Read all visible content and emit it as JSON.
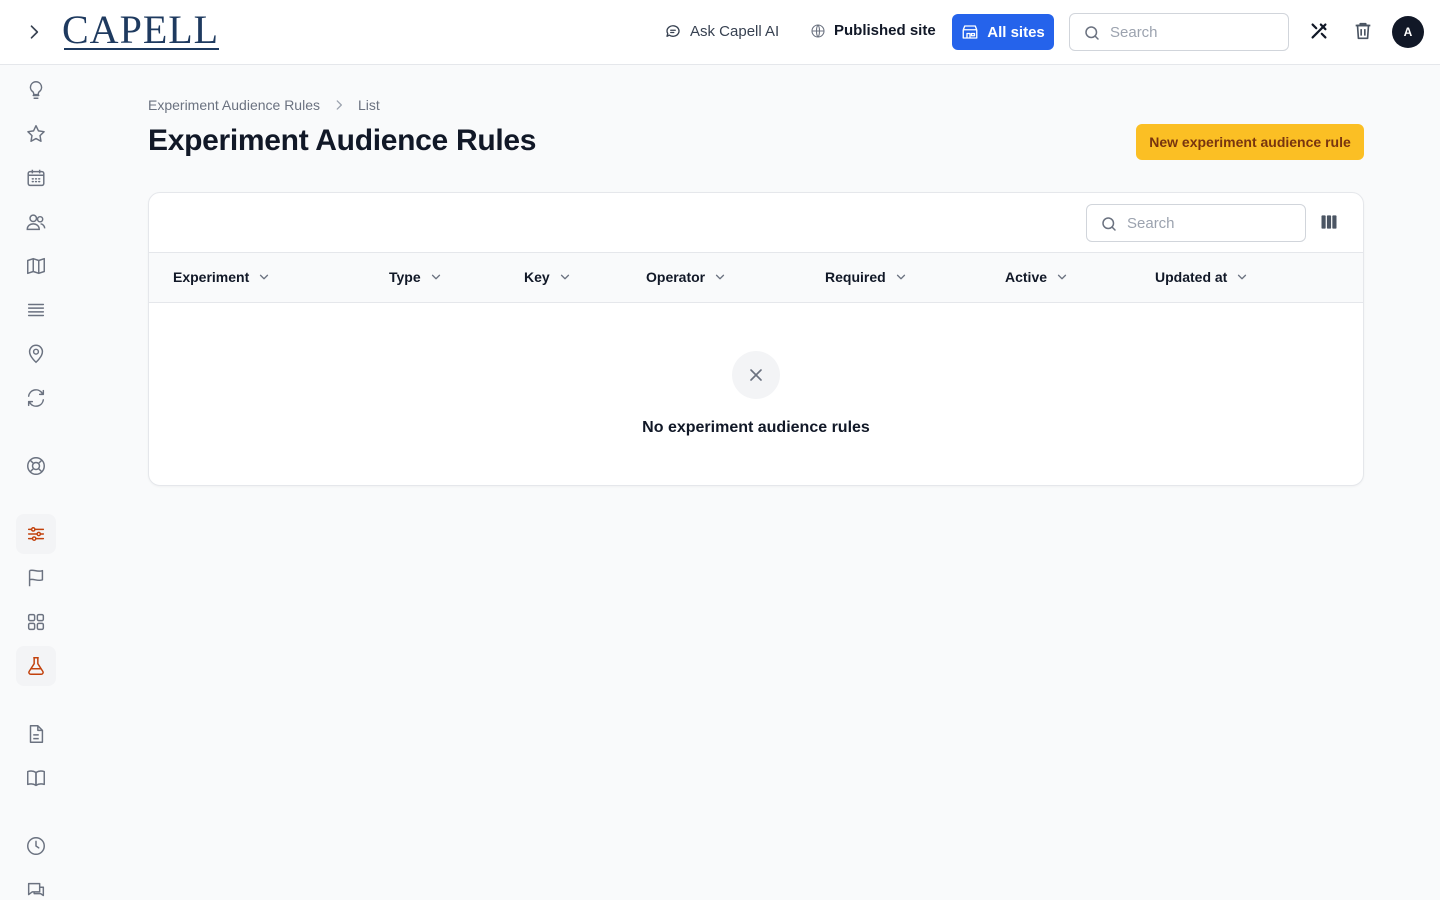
{
  "header": {
    "logo": "CAPELL",
    "ask_ai": "Ask Capell AI",
    "published_site": "Published site",
    "all_sites": "All sites",
    "search_placeholder": "Search",
    "avatar_initial": "A"
  },
  "breadcrumb": {
    "parent": "Experiment Audience Rules",
    "current": "List"
  },
  "page": {
    "title": "Experiment Audience Rules",
    "new_button": "New experiment audience rule"
  },
  "table": {
    "search_placeholder": "Search",
    "columns": [
      "Experiment",
      "Type",
      "Key",
      "Operator",
      "Required",
      "Active",
      "Updated at"
    ],
    "empty_message": "No experiment audience rules"
  },
  "sidebar": {
    "items": [
      {
        "icon": "lightbulb-icon"
      },
      {
        "icon": "star-icon"
      },
      {
        "icon": "calendar-icon"
      },
      {
        "icon": "users-icon"
      },
      {
        "icon": "map-icon"
      },
      {
        "icon": "list-icon"
      },
      {
        "icon": "map-pin-icon"
      },
      {
        "icon": "refresh-icon"
      },
      {
        "icon": "lifebuoy-icon"
      },
      {
        "icon": "sliders-icon",
        "active": true
      },
      {
        "icon": "flag-icon"
      },
      {
        "icon": "grid-icon"
      },
      {
        "icon": "flask-icon",
        "active": true
      },
      {
        "icon": "document-icon"
      },
      {
        "icon": "book-icon"
      },
      {
        "icon": "clock-icon"
      },
      {
        "icon": "chat-icon"
      }
    ]
  },
  "colors": {
    "accent": "#2563eb",
    "primary_button": "#fbbf24",
    "active_icon": "#c2410c"
  }
}
